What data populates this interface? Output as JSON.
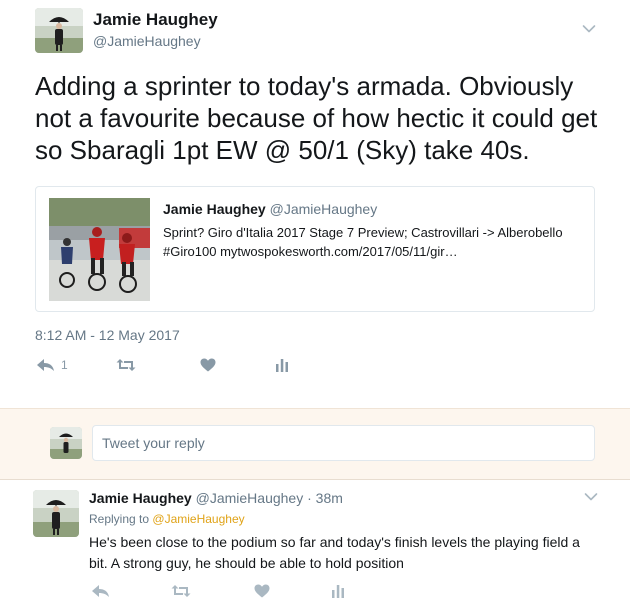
{
  "main_tweet": {
    "author_name": "Jamie Haughey",
    "author_handle": "@JamieHaughey",
    "text": "Adding a sprinter to today's armada. Obviously not a favourite because of how hectic it could get so Sbaragli 1pt EW @ 50/1 (Sky) take 40s.",
    "quoted_tweet": {
      "author_name": "Jamie Haughey",
      "author_handle": "@JamieHaughey",
      "text": "Sprint? Giro d'Italia 2017 Stage 7 Preview; Castrovillari -> Alberobello #Giro100 mytwospokesworth.com/2017/05/11/gir…"
    },
    "timestamp": "8:12 AM - 12 May 2017",
    "actions": {
      "reply_icon": "reply-icon",
      "reply_count": "1",
      "retweet_icon": "retweet-icon",
      "like_icon": "heart-icon",
      "analytics_icon": "analytics-icon"
    }
  },
  "reply_composer": {
    "placeholder": "Tweet your reply"
  },
  "reply_tweet": {
    "author_name": "Jamie Haughey",
    "author_handle": "@JamieHaughey",
    "time": "· 38m",
    "replying_to_label": "Replying to",
    "replying_to_handle": "@JamieHaughey",
    "text": "He's been close to the podium so far and today's finish levels the playing field a bit. A strong guy, he should be able to hold position"
  },
  "colors": {
    "text_primary": "#14171a",
    "text_secondary": "#657786",
    "icon_gray": "#8899a6",
    "composer_background": "#fdf6ee",
    "mention_link": "#e0a318",
    "border": "#e1e8ed"
  }
}
